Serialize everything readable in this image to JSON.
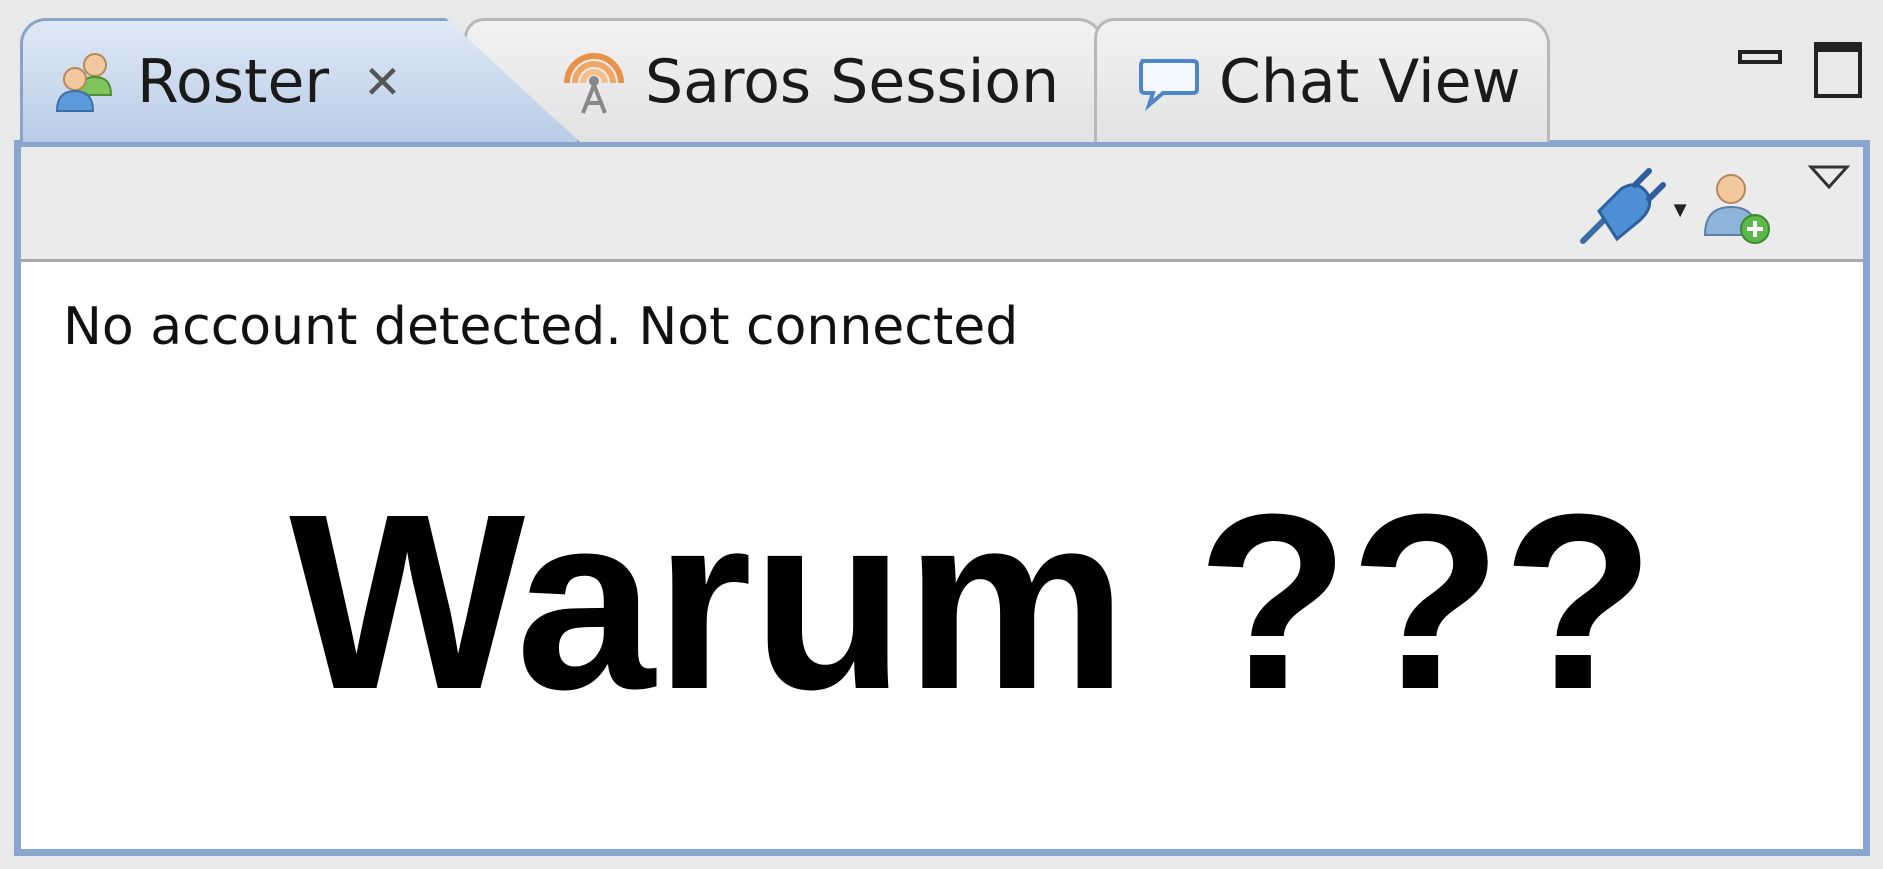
{
  "tabs": [
    {
      "label": "Roster",
      "icon": "roster-icon",
      "active": true,
      "close_icon": "close-icon"
    },
    {
      "label": "Saros Session",
      "icon": "saros-session-icon",
      "active": false
    },
    {
      "label": "Chat View",
      "icon": "chat-bubble-icon",
      "active": false
    }
  ],
  "view_controls": {
    "minimize_icon": "minimize-icon",
    "maximize_icon": "maximize-icon"
  },
  "toolbar": {
    "connect_icon": "connect-plug-icon",
    "dropdown_glyph": "▼",
    "add_contact_icon": "add-contact-icon",
    "view_menu_icon": "view-menu-icon"
  },
  "content": {
    "status": "No account detected. Not connected",
    "overlay": "Warum ???"
  },
  "colors": {
    "active_tab": "#c6d6ec",
    "frame_border": "#8aa6cf",
    "toolbar_bg": "#ebebeb",
    "content_bg": "#ffffff"
  }
}
